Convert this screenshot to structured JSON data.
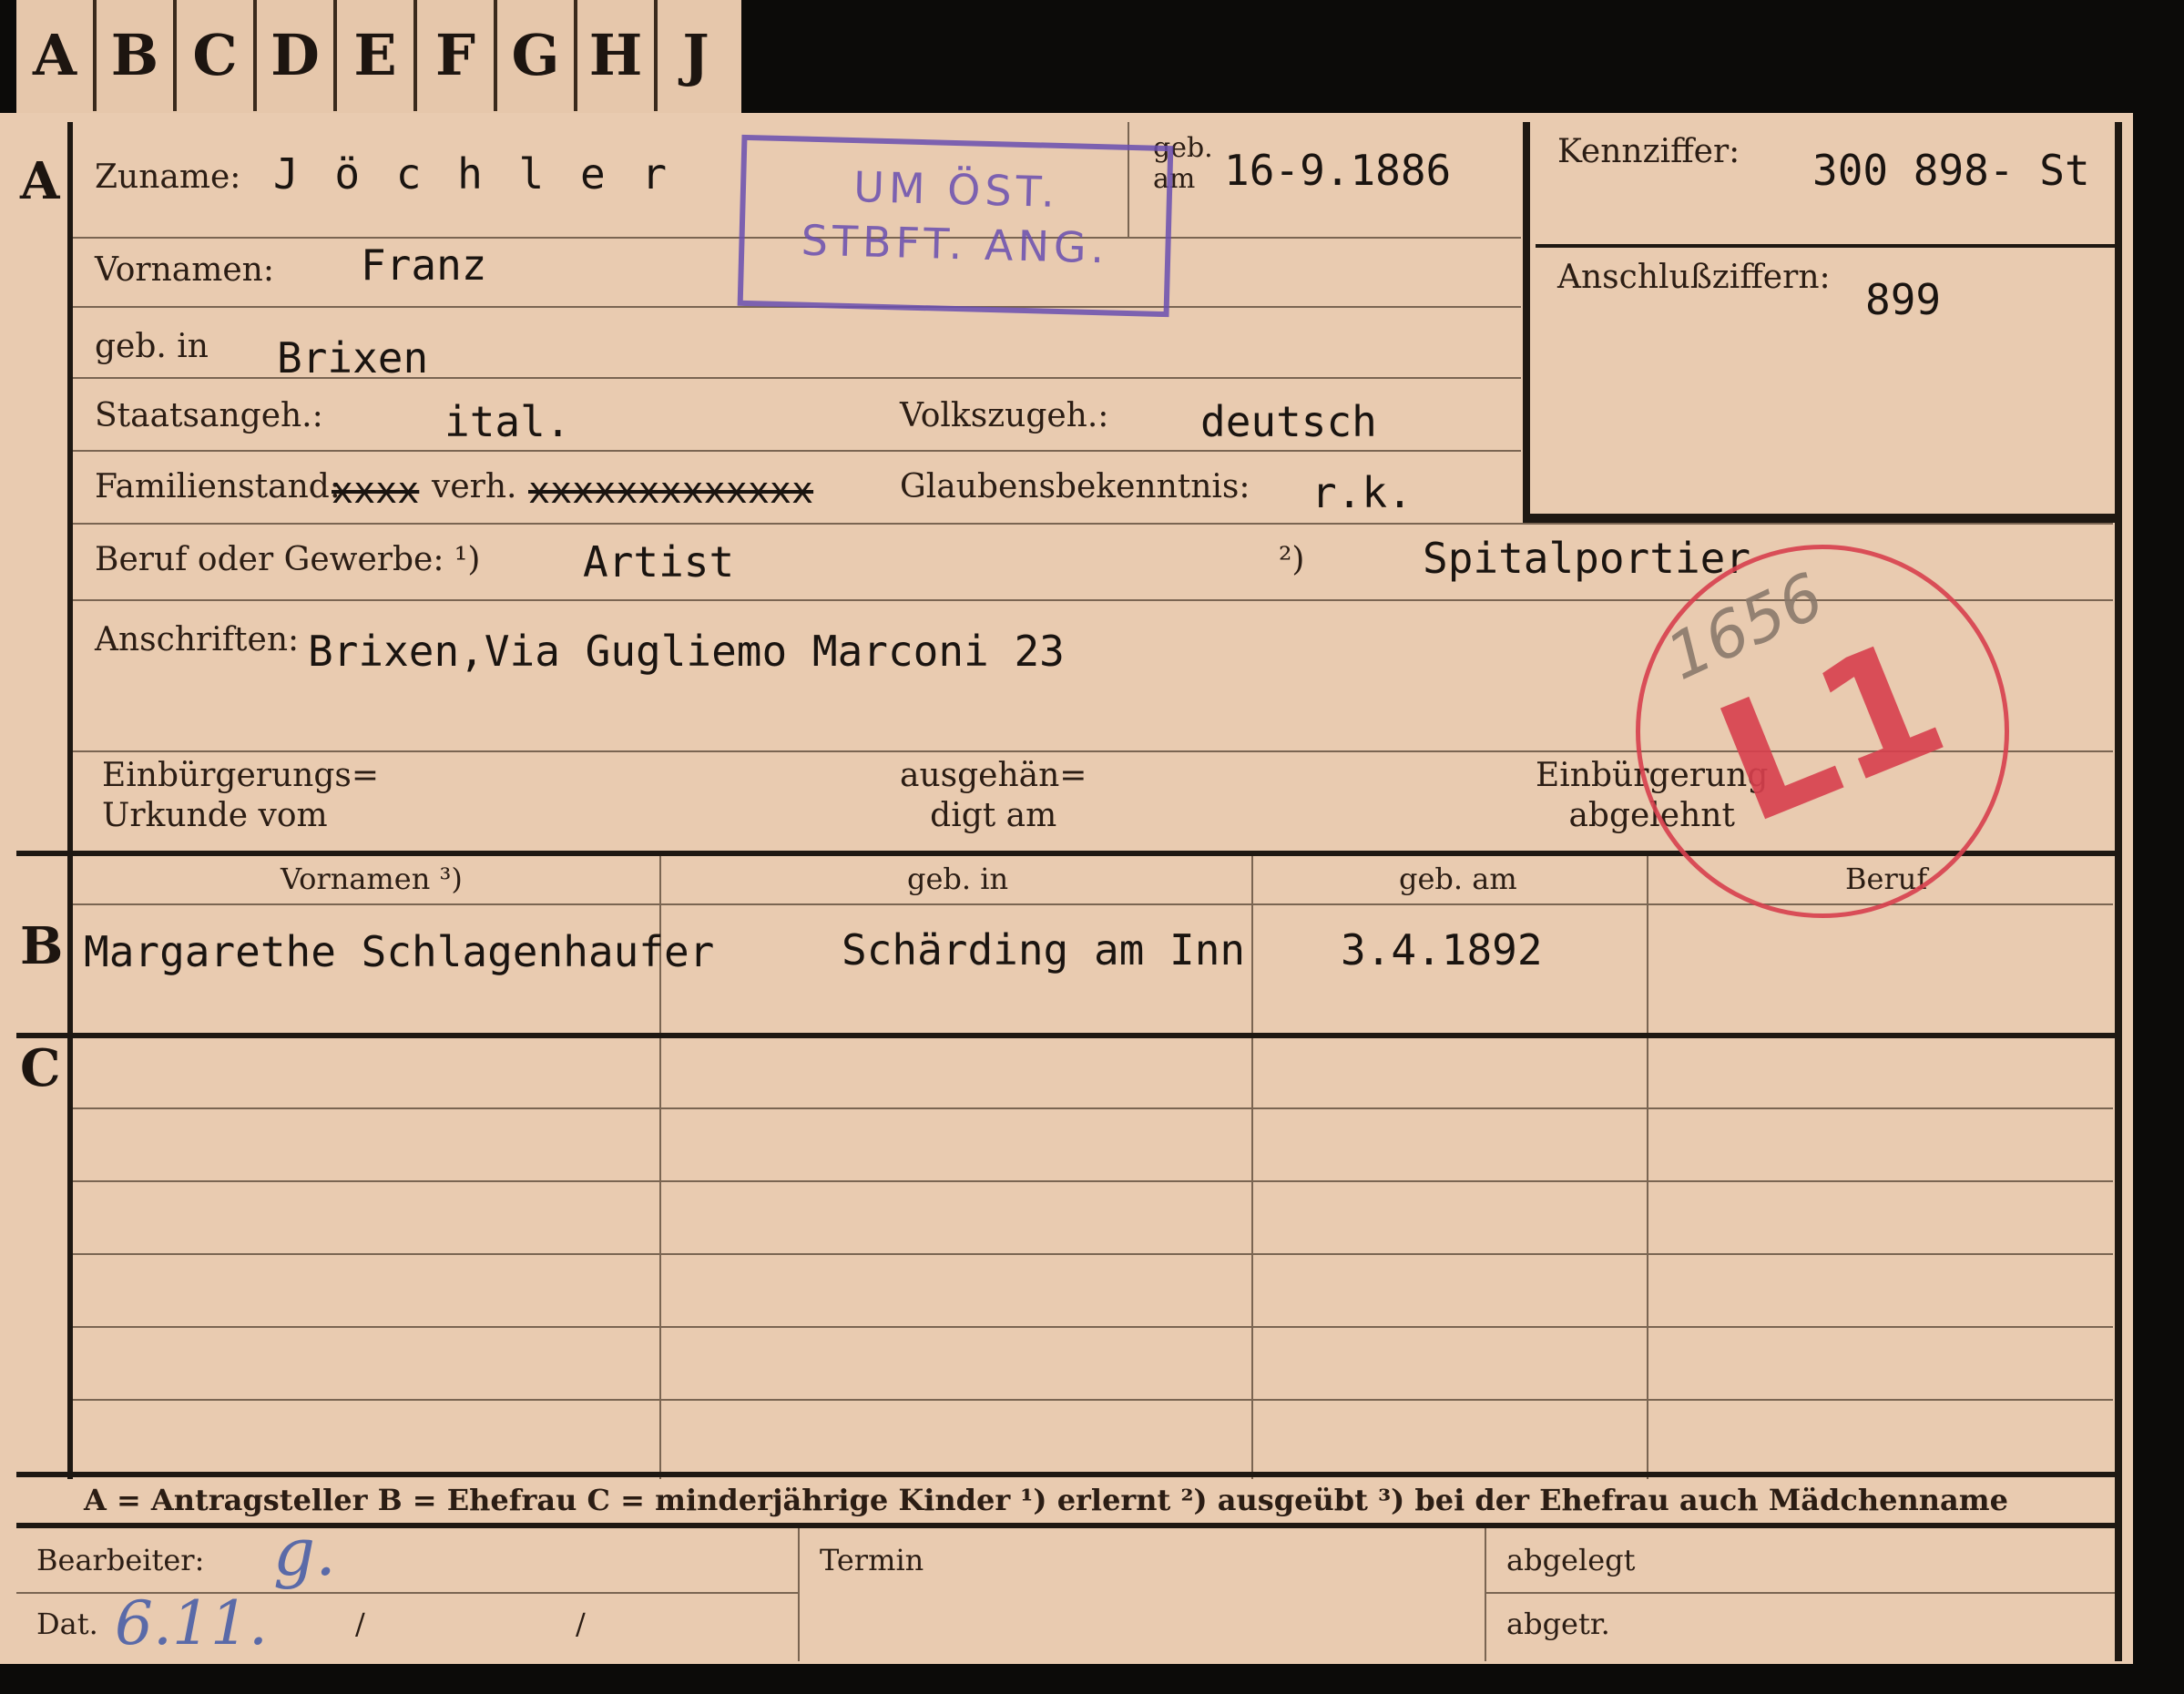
{
  "tabs": [
    "A",
    "B",
    "C",
    "D",
    "E",
    "F",
    "G",
    "H",
    "J"
  ],
  "sections": {
    "a": "A",
    "b": "B",
    "c": "C"
  },
  "labels": {
    "zuname": "Zuname:",
    "geb_am": "geb.\nam",
    "kennziffer": "Kennziffer:",
    "vornamen": "Vornamen:",
    "anschluss": "Anschlußziffern:",
    "geb_in": "geb. in",
    "staatsangeh": "Staatsangeh.:",
    "volkszugeh": "Volkszugeh.:",
    "familienstand": "Familienstand:",
    "verh": "verh.",
    "glauben": "Glaubensbekenntnis:",
    "beruf": "Beruf oder Gewerbe: ¹)",
    "beruf2": "²)",
    "anschriften": "Anschriften:",
    "einb_urkunde": "Einbürgerungs=\nUrkunde vom",
    "ausgehaendigt": "ausgehän=\ndigt am",
    "einb_abgelehnt": "Einbürgerung\nabgelehnt",
    "col_vornamen": "Vornamen ³)",
    "col_geb_in": "geb. in",
    "col_geb_am": "geb. am",
    "col_beruf": "Beruf",
    "legend": "A = Antragsteller   B = Ehefrau   C = minderjährige Kinder   ¹) erlernt   ²) ausgeübt   ³) bei der Ehefrau auch Mädchenname",
    "bearbeiter": "Bearbeiter:",
    "termin": "Termin",
    "abgelegt": "abgelegt",
    "dat": "Dat.",
    "abgetr": "abgetr.",
    "slash1": "/",
    "slash2": "/"
  },
  "values": {
    "zuname": "J ö c h l e r",
    "geb_am": "16-9.1886",
    "kennziffer": "300 898- St",
    "vornamen": "Franz",
    "anschluss": "899",
    "geb_in": "Brixen",
    "staatsangeh": "ital.",
    "volkszugeh": "deutsch",
    "familienstand_struck1": "xxxx",
    "familienstand_struck2": "xxxxxxxxxxxxx",
    "glauben": "r.k.",
    "beruf1": "Artist",
    "beruf2": "Spitalportier",
    "anschrift": "Brixen,Via Gugliemo Marconi 23",
    "spouse": "Margarethe Schlagenhaufer",
    "spouse_geb_in": "Schärding am Inn",
    "spouse_geb_am": "3.4.1892",
    "bearbeiter": "g.",
    "dat": "6.11."
  },
  "stamps": {
    "purple_line1": "UM ÖST.",
    "purple_line2": "STBFT. ANG.",
    "purple_color": "#6a4fb0",
    "red_number": "1656",
    "red_code": "L1",
    "red_color": "#d8404e"
  }
}
